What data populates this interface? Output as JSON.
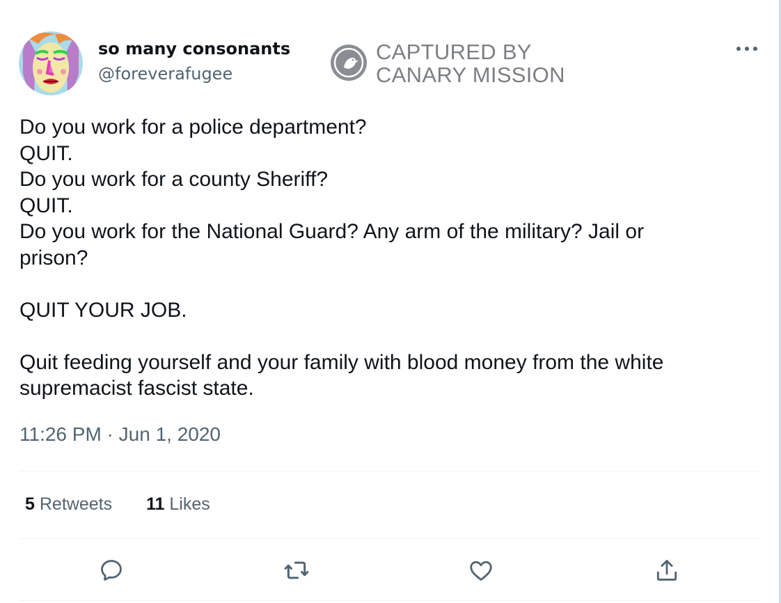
{
  "author": {
    "display_name": "so many consonants",
    "handle": "@foreverafugee",
    "avatar_icon": "illustrated-face-avatar"
  },
  "watermark": {
    "line1": "CAPTURED BY",
    "line2": "CANARY MISSION",
    "icon": "canary-bird-logo"
  },
  "tweet": {
    "lines": [
      "Do you work for a police department?",
      "QUIT.",
      "Do you work for a county Sheriff?",
      "QUIT.",
      "Do you work for the National Guard? Any arm of the military? Jail or",
      "prison?",
      "QUIT YOUR JOB.",
      "Quit feeding yourself and your family with blood money from the white",
      "supremacist fascist state."
    ],
    "timestamp": "11:26 PM · Jun 1, 2020"
  },
  "stats": {
    "retweets_count": "5",
    "retweets_label": "Retweets",
    "likes_count": "11",
    "likes_label": "Likes"
  },
  "actions": [
    "reply-icon",
    "retweet-icon",
    "like-icon",
    "share-icon"
  ],
  "colors": {
    "text": "#0f1419",
    "secondary": "#536471",
    "divider": "#eff3f4",
    "watermark": "#7b7f83"
  }
}
